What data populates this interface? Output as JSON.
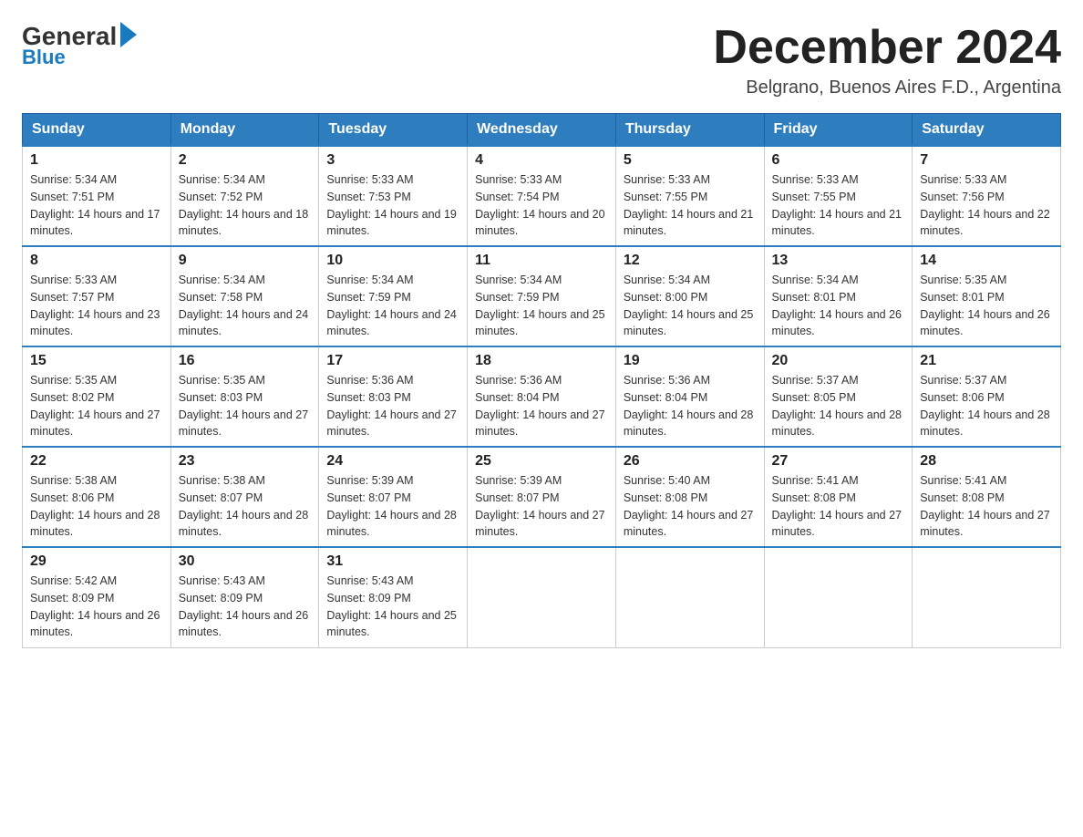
{
  "header": {
    "logo_general": "General",
    "logo_blue": "Blue",
    "month_title": "December 2024",
    "location": "Belgrano, Buenos Aires F.D., Argentina"
  },
  "days_of_week": [
    "Sunday",
    "Monday",
    "Tuesday",
    "Wednesday",
    "Thursday",
    "Friday",
    "Saturday"
  ],
  "weeks": [
    [
      {
        "day": "1",
        "sunrise": "5:34 AM",
        "sunset": "7:51 PM",
        "daylight": "14 hours and 17 minutes."
      },
      {
        "day": "2",
        "sunrise": "5:34 AM",
        "sunset": "7:52 PM",
        "daylight": "14 hours and 18 minutes."
      },
      {
        "day": "3",
        "sunrise": "5:33 AM",
        "sunset": "7:53 PM",
        "daylight": "14 hours and 19 minutes."
      },
      {
        "day": "4",
        "sunrise": "5:33 AM",
        "sunset": "7:54 PM",
        "daylight": "14 hours and 20 minutes."
      },
      {
        "day": "5",
        "sunrise": "5:33 AM",
        "sunset": "7:55 PM",
        "daylight": "14 hours and 21 minutes."
      },
      {
        "day": "6",
        "sunrise": "5:33 AM",
        "sunset": "7:55 PM",
        "daylight": "14 hours and 21 minutes."
      },
      {
        "day": "7",
        "sunrise": "5:33 AM",
        "sunset": "7:56 PM",
        "daylight": "14 hours and 22 minutes."
      }
    ],
    [
      {
        "day": "8",
        "sunrise": "5:33 AM",
        "sunset": "7:57 PM",
        "daylight": "14 hours and 23 minutes."
      },
      {
        "day": "9",
        "sunrise": "5:34 AM",
        "sunset": "7:58 PM",
        "daylight": "14 hours and 24 minutes."
      },
      {
        "day": "10",
        "sunrise": "5:34 AM",
        "sunset": "7:59 PM",
        "daylight": "14 hours and 24 minutes."
      },
      {
        "day": "11",
        "sunrise": "5:34 AM",
        "sunset": "7:59 PM",
        "daylight": "14 hours and 25 minutes."
      },
      {
        "day": "12",
        "sunrise": "5:34 AM",
        "sunset": "8:00 PM",
        "daylight": "14 hours and 25 minutes."
      },
      {
        "day": "13",
        "sunrise": "5:34 AM",
        "sunset": "8:01 PM",
        "daylight": "14 hours and 26 minutes."
      },
      {
        "day": "14",
        "sunrise": "5:35 AM",
        "sunset": "8:01 PM",
        "daylight": "14 hours and 26 minutes."
      }
    ],
    [
      {
        "day": "15",
        "sunrise": "5:35 AM",
        "sunset": "8:02 PM",
        "daylight": "14 hours and 27 minutes."
      },
      {
        "day": "16",
        "sunrise": "5:35 AM",
        "sunset": "8:03 PM",
        "daylight": "14 hours and 27 minutes."
      },
      {
        "day": "17",
        "sunrise": "5:36 AM",
        "sunset": "8:03 PM",
        "daylight": "14 hours and 27 minutes."
      },
      {
        "day": "18",
        "sunrise": "5:36 AM",
        "sunset": "8:04 PM",
        "daylight": "14 hours and 27 minutes."
      },
      {
        "day": "19",
        "sunrise": "5:36 AM",
        "sunset": "8:04 PM",
        "daylight": "14 hours and 28 minutes."
      },
      {
        "day": "20",
        "sunrise": "5:37 AM",
        "sunset": "8:05 PM",
        "daylight": "14 hours and 28 minutes."
      },
      {
        "day": "21",
        "sunrise": "5:37 AM",
        "sunset": "8:06 PM",
        "daylight": "14 hours and 28 minutes."
      }
    ],
    [
      {
        "day": "22",
        "sunrise": "5:38 AM",
        "sunset": "8:06 PM",
        "daylight": "14 hours and 28 minutes."
      },
      {
        "day": "23",
        "sunrise": "5:38 AM",
        "sunset": "8:07 PM",
        "daylight": "14 hours and 28 minutes."
      },
      {
        "day": "24",
        "sunrise": "5:39 AM",
        "sunset": "8:07 PM",
        "daylight": "14 hours and 28 minutes."
      },
      {
        "day": "25",
        "sunrise": "5:39 AM",
        "sunset": "8:07 PM",
        "daylight": "14 hours and 27 minutes."
      },
      {
        "day": "26",
        "sunrise": "5:40 AM",
        "sunset": "8:08 PM",
        "daylight": "14 hours and 27 minutes."
      },
      {
        "day": "27",
        "sunrise": "5:41 AM",
        "sunset": "8:08 PM",
        "daylight": "14 hours and 27 minutes."
      },
      {
        "day": "28",
        "sunrise": "5:41 AM",
        "sunset": "8:08 PM",
        "daylight": "14 hours and 27 minutes."
      }
    ],
    [
      {
        "day": "29",
        "sunrise": "5:42 AM",
        "sunset": "8:09 PM",
        "daylight": "14 hours and 26 minutes."
      },
      {
        "day": "30",
        "sunrise": "5:43 AM",
        "sunset": "8:09 PM",
        "daylight": "14 hours and 26 minutes."
      },
      {
        "day": "31",
        "sunrise": "5:43 AM",
        "sunset": "8:09 PM",
        "daylight": "14 hours and 25 minutes."
      },
      null,
      null,
      null,
      null
    ]
  ]
}
